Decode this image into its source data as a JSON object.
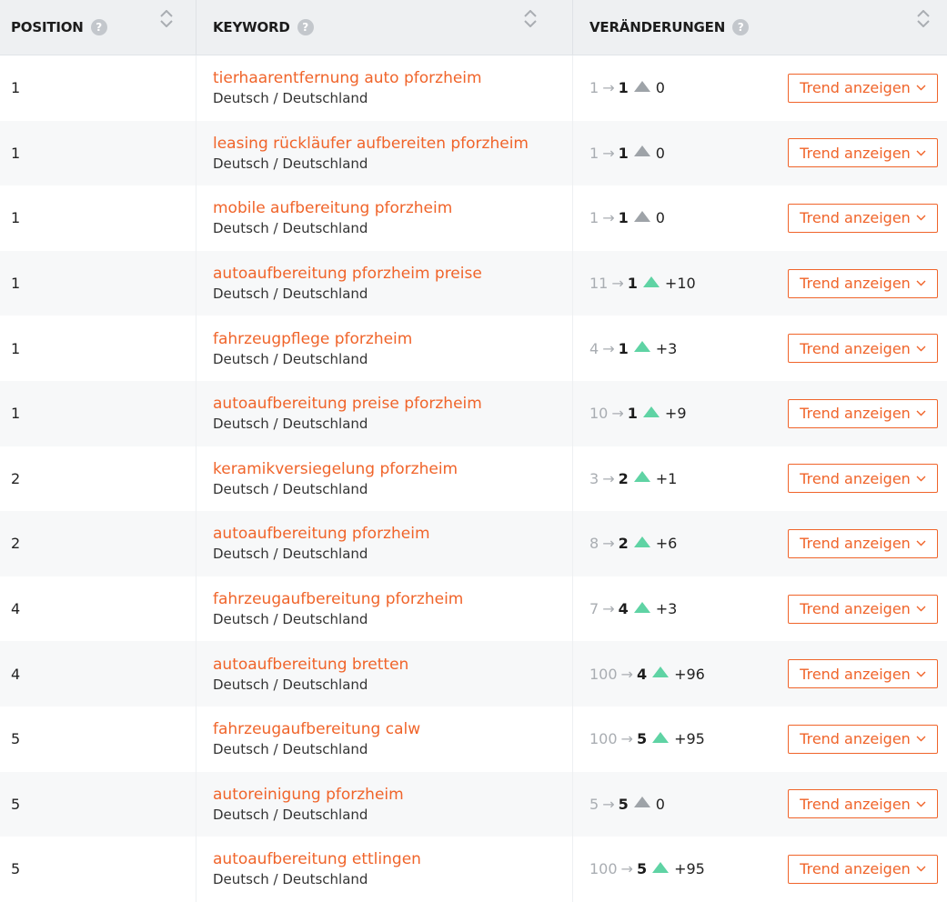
{
  "header": {
    "position_label": "POSITION",
    "keyword_label": "KEYWORD",
    "changes_label": "VERÄNDERUNGEN",
    "help_glyph": "?"
  },
  "trend_button_label": "Trend anzeigen",
  "colors": {
    "accent": "#f0642a",
    "up": "#5fd3a4",
    "neutral": "#9ea3a8"
  },
  "rows": [
    {
      "position": "1",
      "keyword": "tierhaarentfernung auto pforzheim",
      "locale": "Deutsch / Deutschland",
      "prev": "1",
      "arrow": "→",
      "current": "1",
      "delta": "0",
      "direction": "neutral"
    },
    {
      "position": "1",
      "keyword": "leasing rückläufer aufbereiten pforzheim",
      "locale": "Deutsch / Deutschland",
      "prev": "1",
      "arrow": "→",
      "current": "1",
      "delta": "0",
      "direction": "neutral"
    },
    {
      "position": "1",
      "keyword": "mobile aufbereitung pforzheim",
      "locale": "Deutsch / Deutschland",
      "prev": "1",
      "arrow": "→",
      "current": "1",
      "delta": "0",
      "direction": "neutral"
    },
    {
      "position": "1",
      "keyword": "autoaufbereitung pforzheim preise",
      "locale": "Deutsch / Deutschland",
      "prev": "11",
      "arrow": "→",
      "current": "1",
      "delta": "+10",
      "direction": "up"
    },
    {
      "position": "1",
      "keyword": "fahrzeugpflege pforzheim",
      "locale": "Deutsch / Deutschland",
      "prev": "4",
      "arrow": "→",
      "current": "1",
      "delta": "+3",
      "direction": "up"
    },
    {
      "position": "1",
      "keyword": "autoaufbereitung preise pforzheim",
      "locale": "Deutsch / Deutschland",
      "prev": "10",
      "arrow": "→",
      "current": "1",
      "delta": "+9",
      "direction": "up"
    },
    {
      "position": "2",
      "keyword": "keramikversiegelung pforzheim",
      "locale": "Deutsch / Deutschland",
      "prev": "3",
      "arrow": "→",
      "current": "2",
      "delta": "+1",
      "direction": "up"
    },
    {
      "position": "2",
      "keyword": "autoaufbereitung pforzheim",
      "locale": "Deutsch / Deutschland",
      "prev": "8",
      "arrow": "→",
      "current": "2",
      "delta": "+6",
      "direction": "up"
    },
    {
      "position": "4",
      "keyword": "fahrzeugaufbereitung pforzheim",
      "locale": "Deutsch / Deutschland",
      "prev": "7",
      "arrow": "→",
      "current": "4",
      "delta": "+3",
      "direction": "up"
    },
    {
      "position": "4",
      "keyword": "autoaufbereitung bretten",
      "locale": "Deutsch / Deutschland",
      "prev": "100",
      "arrow": "→",
      "current": "4",
      "delta": "+96",
      "direction": "up"
    },
    {
      "position": "5",
      "keyword": "fahrzeugaufbereitung calw",
      "locale": "Deutsch / Deutschland",
      "prev": "100",
      "arrow": "→",
      "current": "5",
      "delta": "+95",
      "direction": "up"
    },
    {
      "position": "5",
      "keyword": "autoreinigung pforzheim",
      "locale": "Deutsch / Deutschland",
      "prev": "5",
      "arrow": "→",
      "current": "5",
      "delta": "0",
      "direction": "neutral"
    },
    {
      "position": "5",
      "keyword": "autoaufbereitung ettlingen",
      "locale": "Deutsch / Deutschland",
      "prev": "100",
      "arrow": "→",
      "current": "5",
      "delta": "+95",
      "direction": "up"
    }
  ]
}
